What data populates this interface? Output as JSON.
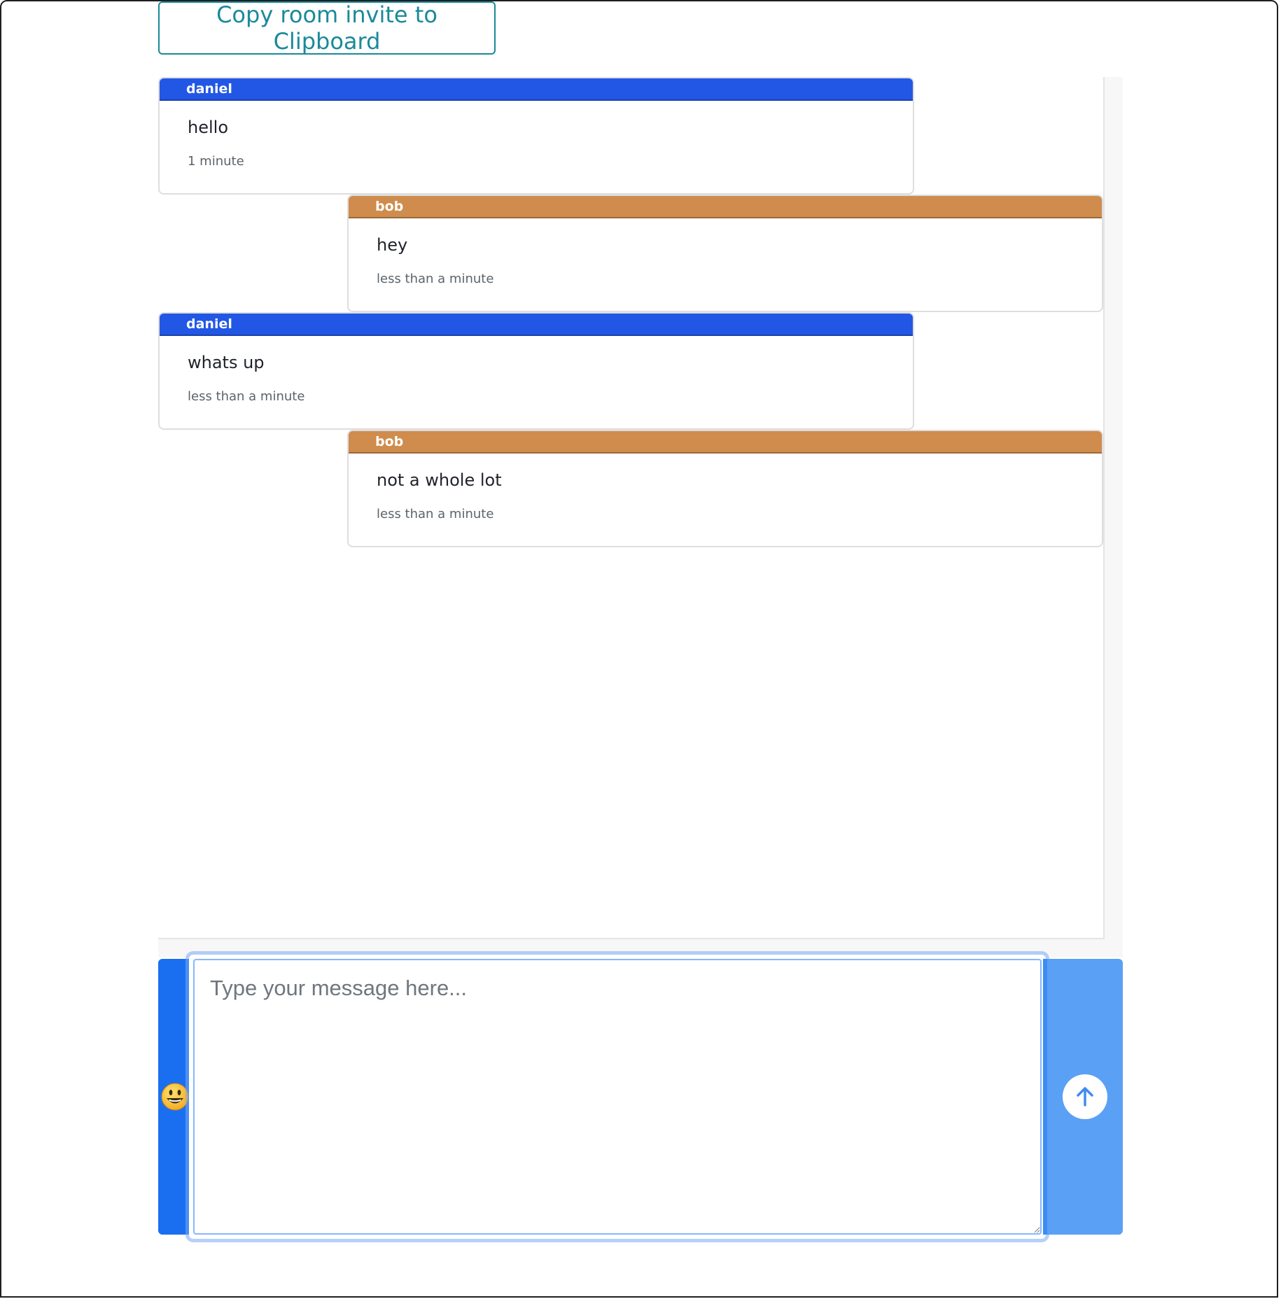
{
  "toolbar": {
    "invite_label": "Copy room invite to Clipboard"
  },
  "messages": [
    {
      "user": "daniel",
      "text": "hello",
      "time": "1 minute",
      "color": "#2257e6"
    },
    {
      "user": "bob",
      "text": "hey",
      "time": "less than a minute",
      "color": "#cf8c4c"
    },
    {
      "user": "daniel",
      "text": "whats up",
      "time": "less than a minute",
      "color": "#2257e6"
    },
    {
      "user": "bob",
      "text": "not a whole lot",
      "time": "less than a minute",
      "color": "#cf8c4c"
    }
  ],
  "composer": {
    "placeholder": "Type your message here...",
    "value": "",
    "emoji_icon": "smiley-face-icon",
    "send_icon": "arrow-up-icon"
  },
  "colors": {
    "accent": "#1a6ff0",
    "send": "#5aa0f5",
    "invite_border": "#1a8a99"
  }
}
